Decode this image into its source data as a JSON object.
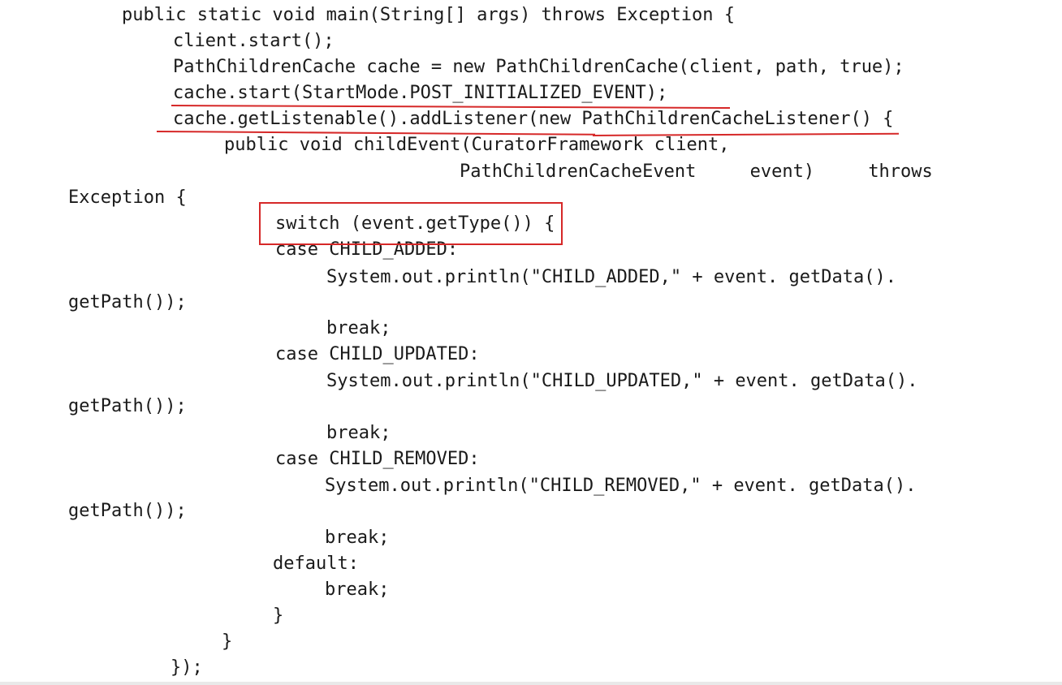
{
  "code_lines": [
    "public static void main(String[] args) throws Exception {",
    "client.start();",
    "PathChildrenCache cache = new PathChildrenCache(client, path, true);",
    "cache.start(StartMode.POST_INITIALIZED_EVENT);",
    "cache.getListenable().addListener(new PathChildrenCacheListener() {",
    "public void childEvent(CuratorFramework client,",
    "PathChildrenCacheEvent     event)     throws",
    "Exception {",
    "switch (event.getType()) {",
    "case CHILD_ADDED:",
    "System.out.println(\"CHILD_ADDED,\" + event. getData().",
    "getPath());",
    "break;",
    "case CHILD_UPDATED:",
    "System.out.println(\"CHILD_UPDATED,\" + event. getData().",
    "getPath());",
    "break;",
    "case CHILD_REMOVED:",
    "System.out.println(\"CHILD_REMOVED,\" + event. getData().",
    "getPath());",
    "break;",
    "default:",
    "break;",
    "}",
    "}",
    "});"
  ],
  "annotation_color": "#d62828"
}
